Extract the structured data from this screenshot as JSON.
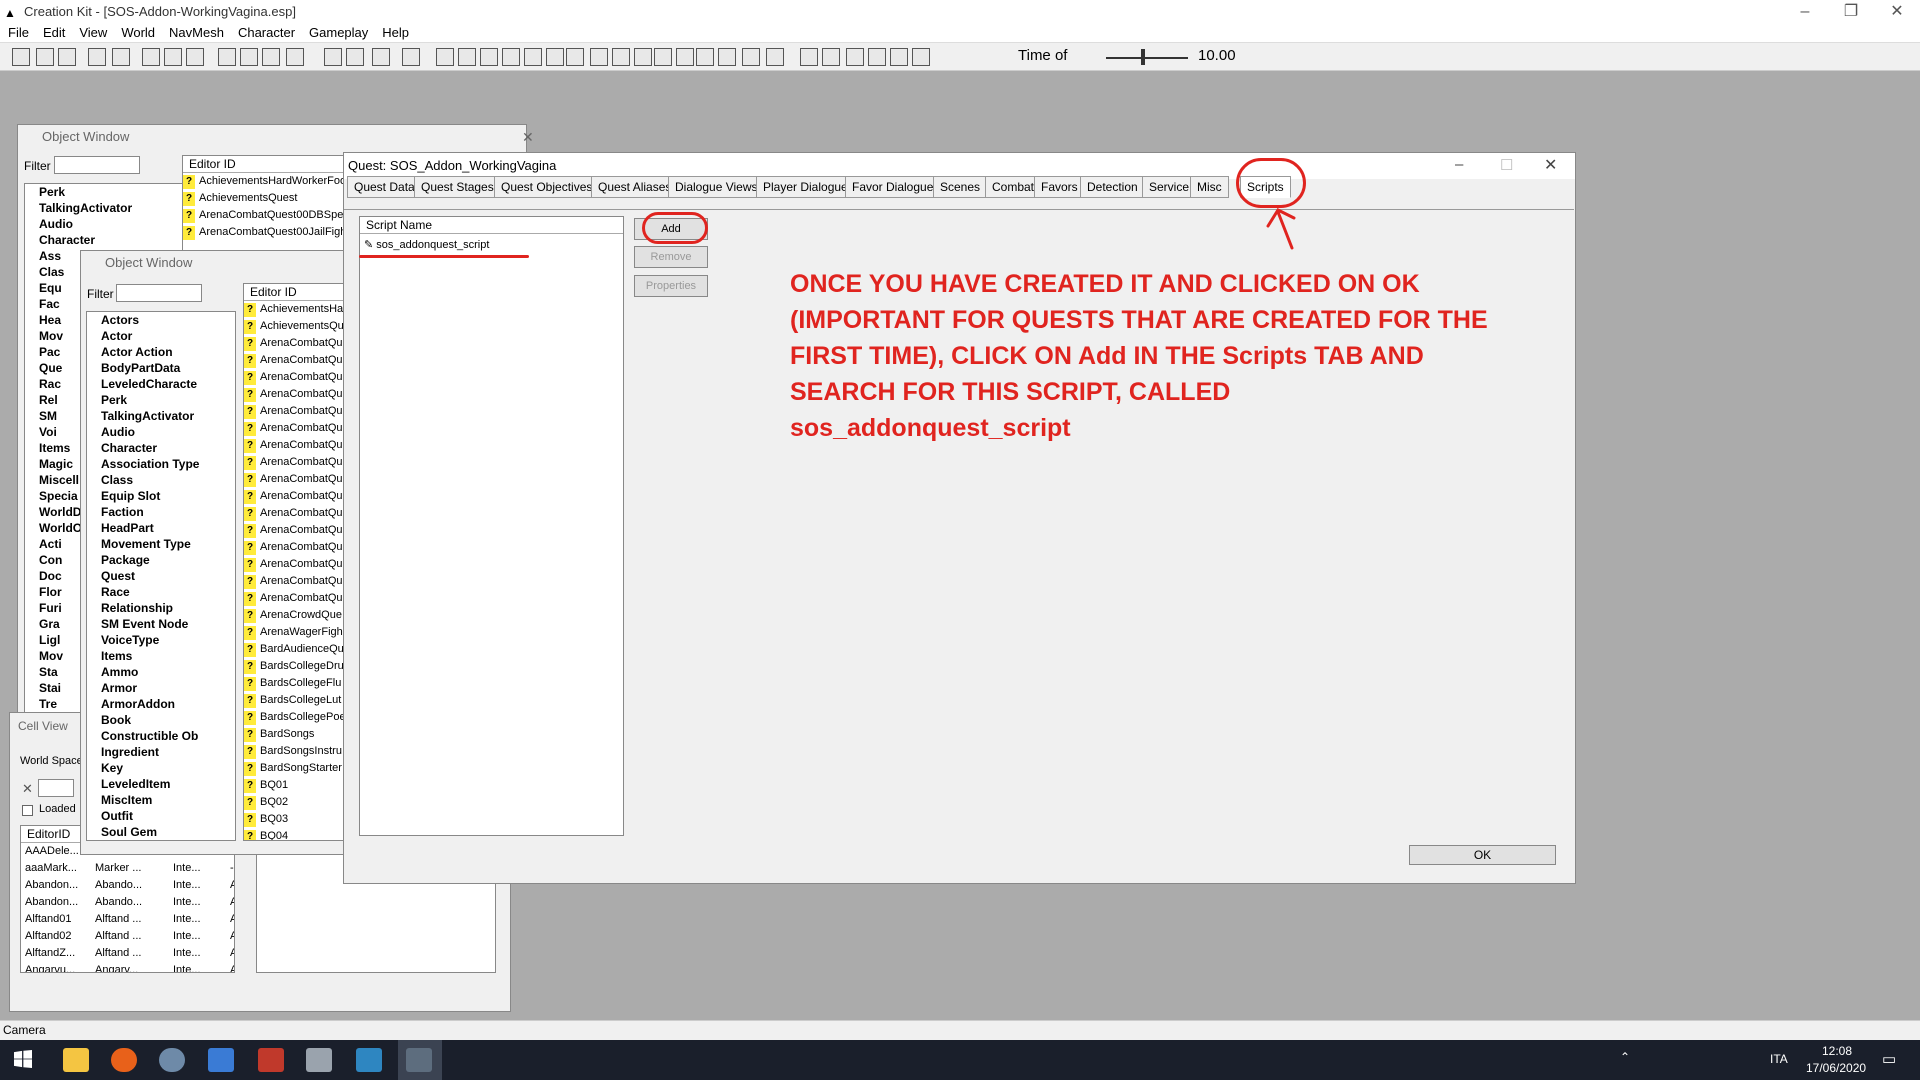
{
  "app": {
    "title": "Creation Kit - [SOS-Addon-WorkingVagina.esp]"
  },
  "menu": [
    "File",
    "Edit",
    "View",
    "World",
    "NavMesh",
    "Character",
    "Gameplay",
    "Help"
  ],
  "toolbar": {
    "time_label": "Time of",
    "time_value": "10.00"
  },
  "object_window_1": {
    "title": "Object Window",
    "filter_label": "Filter",
    "editor_id_header": "Editor ID",
    "tree": [
      "Perk",
      "TalkingActivator",
      "Audio",
      "Character",
      "Ass",
      "Clas",
      "Equ",
      "Fac",
      "Hea",
      "Mov",
      "Pac",
      "Que",
      "Rac",
      "Rel",
      "SM",
      "Voi",
      "Items",
      "Magic",
      "Miscell",
      "Specia",
      "WorldD",
      "WorldO",
      "Acti",
      "Con",
      "Doc",
      "Flor",
      "Furi",
      "Gra",
      "Ligl",
      "Mov",
      "Sta",
      "Stai",
      "Tre"
    ],
    "list": [
      "AchievementsHardWorkerFoo",
      "AchievementsQuest",
      "ArenaCombatQuest00DBSpec",
      "ArenaCombatQuest00JailFigh"
    ]
  },
  "object_window_2": {
    "title": "Object Window",
    "filter_label": "Filter",
    "editor_id_header": "Editor ID",
    "tree": [
      "Actors",
      "Actor",
      "Actor Action",
      "BodyPartData",
      "LeveledCharacte",
      "Perk",
      "TalkingActivator",
      "Audio",
      "Character",
      "Association Type",
      "Class",
      "Equip Slot",
      "Faction",
      "HeadPart",
      "Movement Type",
      "Package",
      "Quest",
      "Race",
      "Relationship",
      "SM Event Node",
      "VoiceType",
      "Items",
      "Ammo",
      "Armor",
      "ArmorAddon",
      "Book",
      "Constructible Ob",
      "Ingredient",
      "Key",
      "LeveledItem",
      "MiscItem",
      "Outfit",
      "Soul Gem"
    ],
    "list": [
      "AchievementsHa",
      "AchievementsQu",
      "ArenaCombatQu",
      "ArenaCombatQu",
      "ArenaCombatQu",
      "ArenaCombatQu",
      "ArenaCombatQu",
      "ArenaCombatQu",
      "ArenaCombatQu",
      "ArenaCombatQu",
      "ArenaCombatQu",
      "ArenaCombatQu",
      "ArenaCombatQu",
      "ArenaCombatQu",
      "ArenaCombatQu",
      "ArenaCombatQu",
      "ArenaCombatQu",
      "ArenaCombatQu",
      "ArenaCrowdQue",
      "ArenaWagerFigh",
      "BardAudienceQu",
      "BardsCollegeDru",
      "BardsCollegeFlu",
      "BardsCollegeLut",
      "BardsCollegePoe",
      "BardSongs",
      "BardSongsInstru",
      "BardSongStarter",
      "BQ01",
      "BQ02",
      "BQ03",
      "BQ04"
    ]
  },
  "cell_view": {
    "title": "Cell View",
    "world_space_label": "World Space",
    "loaded_label": "Loaded",
    "editor_id_header": "EditorID",
    "rows": [
      [
        "AAADele...",
        "",
        "",
        ""
      ],
      [
        "aaaMark...",
        "Marker ...",
        "Inte...",
        "-"
      ],
      [
        "Abandon...",
        "Abando...",
        "Inte...",
        "A"
      ],
      [
        "Abandon...",
        "Abando...",
        "Inte...",
        "A"
      ],
      [
        "Alftand01",
        "Alftand ...",
        "Inte...",
        "A"
      ],
      [
        "Alftand02",
        "Alftand ...",
        "Inte...",
        "A"
      ],
      [
        "AlftandZ...",
        "Alftand ...",
        "Inte...",
        "A"
      ],
      [
        "Angarvu...",
        "Angarv...",
        "Inte...",
        "A"
      ]
    ]
  },
  "quest_dialog": {
    "title": "Quest: SOS_Addon_WorkingVagina",
    "tabs": [
      "Quest Data",
      "Quest Stages",
      "Quest Objectives",
      "Quest Aliases",
      "Dialogue Views",
      "Player Dialogue",
      "Favor Dialogue",
      "Scenes",
      "Combat",
      "Favors",
      "Detection",
      "Service",
      "Misc",
      "Scripts"
    ],
    "active_tab": "Scripts",
    "script_name_header": "Script Name",
    "scripts": [
      "sos_addonquest_script"
    ],
    "add_label": "Add",
    "remove_label": "Remove",
    "properties_label": "Properties",
    "ok_label": "OK"
  },
  "annotation": {
    "text": "ONCE YOU HAVE CREATED IT AND CLICKED ON OK (IMPORTANT FOR QUESTS THAT ARE CREATED FOR THE FIRST TIME), CLICK ON  Add  IN THE Scripts TAB AND SEARCH FOR THIS SCRIPT, CALLED  sos_addonquest_script",
    "color": "#e0241f"
  },
  "status_bar": {
    "text": "Camera"
  },
  "taskbar": {
    "language": "ITA",
    "time": "12:08",
    "date": "17/06/2020"
  }
}
